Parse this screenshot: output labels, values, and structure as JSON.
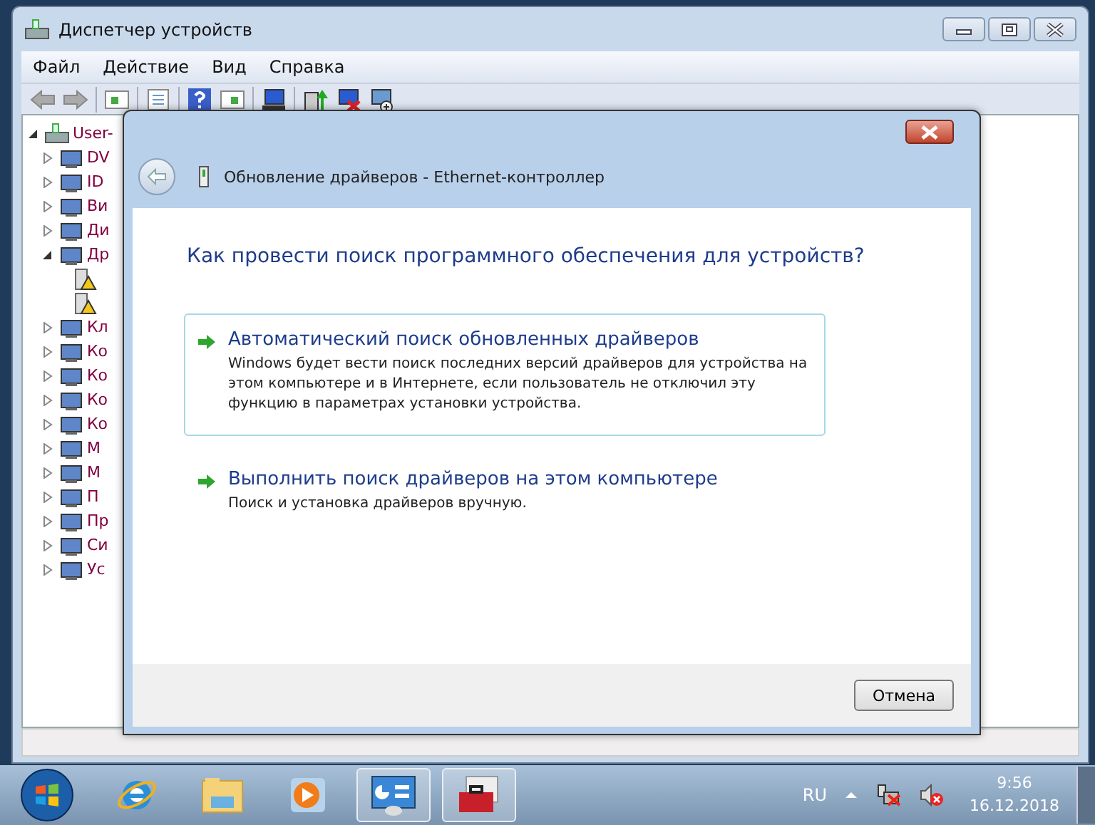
{
  "window": {
    "title": "Диспетчер устройств"
  },
  "menu": [
    "Файл",
    "Действие",
    "Вид",
    "Справка"
  ],
  "tree": {
    "label": "User-",
    "expanded": true,
    "children": [
      {
        "label": "DV",
        "expanded": false
      },
      {
        "label": "ID",
        "expanded": false
      },
      {
        "label": "Ви",
        "expanded": false
      },
      {
        "label": "Ди",
        "expanded": false
      },
      {
        "label": "Др",
        "expanded": true,
        "children": [
          {
            "warning": true
          },
          {
            "warning": true
          }
        ]
      },
      {
        "label": "Кл",
        "expanded": false
      },
      {
        "label": "Ко",
        "expanded": false
      },
      {
        "label": "Ко",
        "expanded": false
      },
      {
        "label": "Ко",
        "expanded": false
      },
      {
        "label": "Ко",
        "expanded": false
      },
      {
        "label": "М",
        "expanded": false
      },
      {
        "label": "М",
        "expanded": false
      },
      {
        "label": "П",
        "expanded": false
      },
      {
        "label": "Пр",
        "expanded": false
      },
      {
        "label": "Си",
        "expanded": false
      },
      {
        "label": "Ус",
        "expanded": false
      }
    ]
  },
  "dialog": {
    "title": "Обновление драйверов - Ethernet-контроллер",
    "heading": "Как провести поиск программного обеспечения для устройств?",
    "options": [
      {
        "title": "Автоматический поиск обновленных драйверов",
        "description": "Windows будет вести поиск последних версий драйверов для устройства на этом компьютере и в Интернете, если пользователь не отключил эту функцию в параметрах установки устройства.",
        "selected": true
      },
      {
        "title": "Выполнить поиск драйверов на этом компьютере",
        "description": "Поиск и установка драйверов вручную.",
        "selected": false
      }
    ],
    "cancel": "Отмена"
  },
  "taskbar": {
    "apps": [
      {
        "kind": "ie",
        "running": false
      },
      {
        "kind": "explorer",
        "running": false
      },
      {
        "kind": "media",
        "running": false
      },
      {
        "kind": "control",
        "running": true
      },
      {
        "kind": "toolbox",
        "running": true
      }
    ],
    "language": "RU",
    "time": "9:56",
    "date": "16.12.2018"
  }
}
